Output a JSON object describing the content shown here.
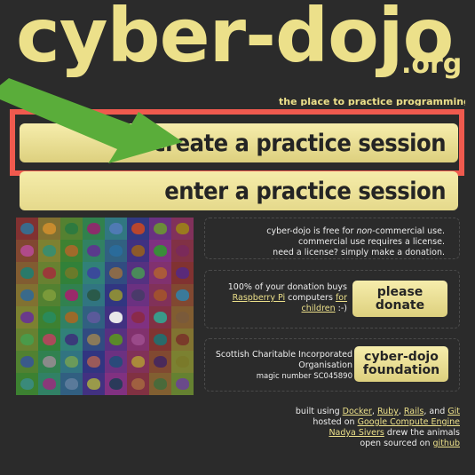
{
  "logo": {
    "main": "cyber-dojo",
    "suffix": ".org"
  },
  "tagline": "the place to practice programming",
  "buttons": {
    "create": "create a practice session",
    "enter": "enter a practice session"
  },
  "colors": {
    "accent": "#ece08a",
    "background": "#2b2b2b",
    "highlight": "#f05a4e",
    "arrow": "#5aad3a"
  },
  "animals": [
    "#3a6b8c",
    "#c78b2e",
    "#2e7a3f",
    "#8b2e6b",
    "#4f7ab3",
    "#b8462d",
    "#6b8c3a",
    "#9a7a1e",
    "#b04a8a",
    "#3d8c6b",
    "#a06a2a",
    "#5a3a8c",
    "#2a6b9a",
    "#8c5a2a",
    "#3a8c3a",
    "#7a2a5a",
    "#2a7a6a",
    "#9a3a3a",
    "#6a7a2a",
    "#3a4a9a",
    "#8a6a4a",
    "#4a8a5a",
    "#aa5a3a",
    "#5a2a7a",
    "#3a6a8a",
    "#7a9a3a",
    "#9a2a6a",
    "#2a5a4a",
    "#8a8a3a",
    "#4a3a6a",
    "#a05030",
    "#3a7a9a",
    "#6a3a8a",
    "#2a8a5a",
    "#9a6a2a",
    "#5a5a9a",
    "#e8e8e8",
    "#8a2a4a",
    "#3a9a8a",
    "#7a5a3a",
    "#4a9a4a",
    "#aa4a5a",
    "#3a3a7a",
    "#8a7a5a",
    "#5a8a2a",
    "#9a4a8a",
    "#2a6a6a",
    "#7a3a2a",
    "#3a5a8a",
    "#8a8a8a",
    "#6a9a5a",
    "#9a5a5a",
    "#2a4a7a",
    "#aa8a3a",
    "#4a2a5a",
    "#7a7a2a",
    "#3a8a7a",
    "#8a3a7a",
    "#5a7a9a",
    "#9a9a4a",
    "#2a3a5a",
    "#a06040",
    "#4a6a3a",
    "#6a4a8a"
  ],
  "free_panel": {
    "line1_pre": "cyber-dojo is free for ",
    "line1_em": "non",
    "line1_post": "-commercial use.",
    "line2": "commercial use requires a license.",
    "line3": "need a license? simply make a donation."
  },
  "donate_panel": {
    "line1": "100% of your donation buys",
    "link1": "Raspberry Pi",
    "mid": " computers ",
    "link2": "for",
    "link3": "children",
    "end": " :-)",
    "button": "please donate"
  },
  "foundation_panel": {
    "line1": "Scottish Charitable Incorporated",
    "line2": "Organisation",
    "line3": "magic number SC045890",
    "button": "cyber-dojo foundation"
  },
  "credits": {
    "built": "built using ",
    "docker": "Docker",
    "ruby": "Ruby",
    "rails": "Rails",
    "and": ", and ",
    "git": "Git",
    "hosted": "hosted on ",
    "gce": "Google Compute Engine",
    "nadya": "Nadya Sivers",
    "drew": " drew the animals",
    "open": "open sourced on ",
    "github": "github"
  }
}
